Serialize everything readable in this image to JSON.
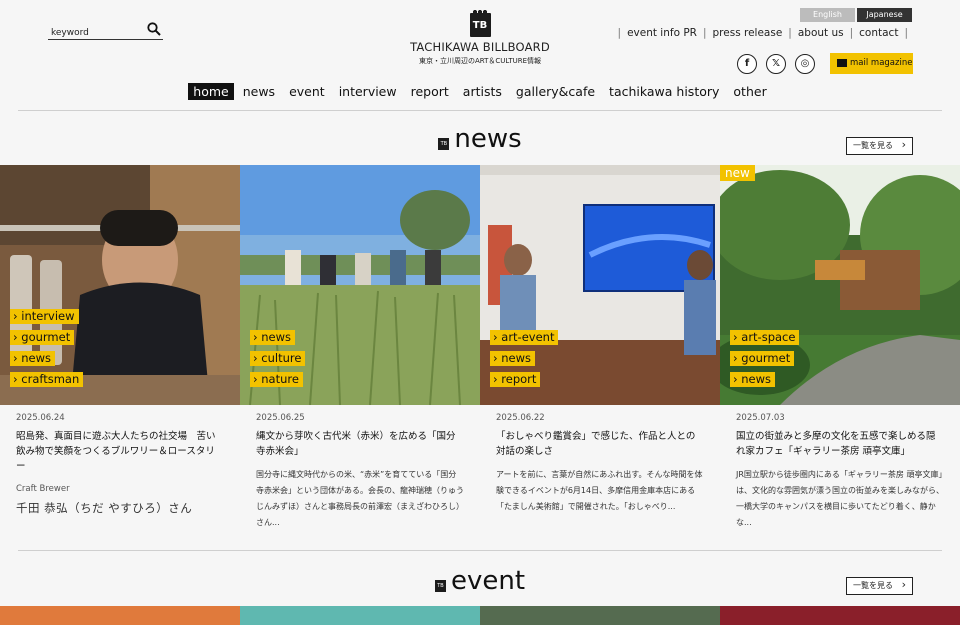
{
  "search": {
    "placeholder": "keyword"
  },
  "logo": {
    "mark": "TB",
    "name": "TACHIKAWA BILLBOARD",
    "tagline": "東京・立川周辺のART＆CULTURE情報"
  },
  "lang": {
    "english": "English",
    "japanese": "Japanese"
  },
  "toplinks": [
    "event info PR",
    "press release",
    "about us",
    "contact"
  ],
  "social": [
    {
      "icon": "facebook-icon",
      "glyph": "f"
    },
    {
      "icon": "x-icon",
      "glyph": "𝕏"
    },
    {
      "icon": "instagram-icon",
      "glyph": "◎"
    }
  ],
  "mail_magazine": "mail magazine",
  "nav": [
    "home",
    "news",
    "event",
    "interview",
    "report",
    "artists",
    "gallery&cafe",
    "tachikawa history",
    "other"
  ],
  "news_section": {
    "title": "news",
    "more": "一覧を見る"
  },
  "event_section": {
    "title": "event",
    "more": "一覧を見る"
  },
  "cards": [
    {
      "tags": [
        "interview",
        "gourmet",
        "news",
        "craftsman"
      ],
      "new": "",
      "date": "2025.06.24",
      "title": "昭島発、真面目に遊ぶ大人たちの社交場　苦い飲み物で笑顔をつくるブルワリー＆ロースタリー",
      "desc": "",
      "category": "Craft Brewer",
      "person": "千田 恭弘（ちだ やすひろ）さん"
    },
    {
      "tags": [
        "news",
        "culture",
        "nature"
      ],
      "new": "",
      "date": "2025.06.25",
      "title": "縄文から芽吹く古代米（赤米）を広める「国分寺赤米会」",
      "desc": "国分寺に縄文時代からの米、“赤米”を育てている「国分寺赤米会」という団体がある。会長の、龍神瑞穂（りゅうじんみずほ）さんと事務局長の前澤宏（まえざわひろし）さん...",
      "category": "",
      "person": ""
    },
    {
      "tags": [
        "art-event",
        "news",
        "report"
      ],
      "new": "",
      "date": "2025.06.22",
      "title": "「おしゃべり鑑賞会」で感じた、作品と人との対話の楽しさ",
      "desc": "アートを前に、言葉が自然にあふれ出す。そんな時間を体験できるイベントが6月14日、多摩信用金庫本店にある「たましん美術館」で開催された。「おしゃべり...",
      "category": "",
      "person": ""
    },
    {
      "tags": [
        "art-space",
        "gourmet",
        "news"
      ],
      "new": "new",
      "date": "2025.07.03",
      "title": "国立の街並みと多摩の文化を五感で楽しめる隠れ家カフェ「ギャラリー茶房 頑亭文庫」",
      "desc": "JR国立駅から徒歩圏内にある「ギャラリー茶房 頑亭文庫」は、文化的な雰囲気が漂う国立の街並みを楽しみながら、一橋大学のキャンパスを横目に歩いてたどり着く、静かな...",
      "category": "",
      "person": ""
    }
  ],
  "colors": {
    "accent": "#f2c200",
    "dark": "#111111",
    "background": "#f6f6f6"
  }
}
